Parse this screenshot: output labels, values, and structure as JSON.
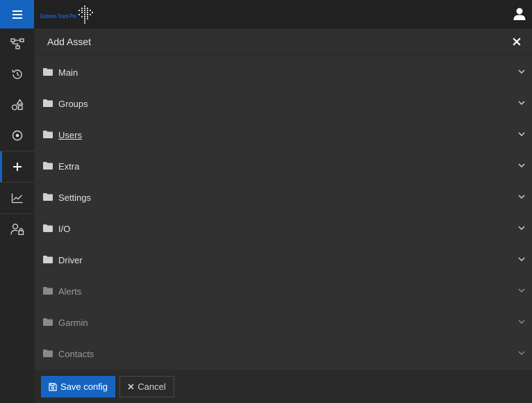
{
  "header": {
    "logo_text": "Extreme Track Pro",
    "menu_icon": "hamburger-icon",
    "user_icon": "user-icon"
  },
  "sidebar": {
    "items": [
      {
        "icon": "network-icon",
        "active": false
      },
      {
        "icon": "history-icon",
        "active": false
      },
      {
        "icon": "shapes-icon",
        "active": false
      },
      {
        "icon": "target-icon",
        "active": false
      },
      {
        "icon": "plus-icon",
        "active": true
      },
      {
        "icon": "chart-line-icon",
        "active": false
      },
      {
        "icon": "user-lock-icon",
        "active": false
      }
    ]
  },
  "panel": {
    "title": "Add Asset",
    "close_icon": "close-icon",
    "sections": [
      {
        "label": "Main"
      },
      {
        "label": "Groups"
      },
      {
        "label": "Users"
      },
      {
        "label": "Extra"
      },
      {
        "label": "Settings"
      },
      {
        "label": "I/O"
      },
      {
        "label": "Driver"
      },
      {
        "label": "Alerts"
      },
      {
        "label": "Garmin"
      },
      {
        "label": "Contacts"
      }
    ]
  },
  "footer": {
    "save_label": "Save config",
    "cancel_label": "Cancel"
  },
  "colors": {
    "accent": "#1565c0",
    "background": "#313131",
    "sidebar": "#252525"
  }
}
